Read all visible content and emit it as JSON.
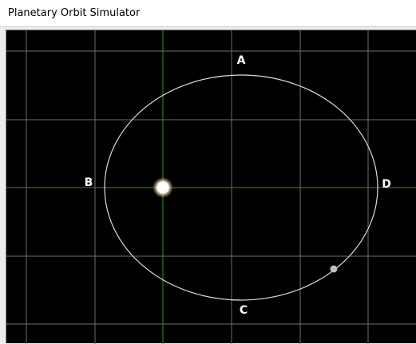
{
  "window": {
    "title": "Planetary Orbit Simulator"
  },
  "simulation": {
    "background_color": "#000000",
    "grid_color": "#6e6e6e",
    "axis_color": "#2f8f2f",
    "orbit_color": "#dcdcdc",
    "star_color": "#ffffff",
    "planet_color": "#bfbfbf",
    "points": {
      "A": "A",
      "B": "B",
      "C": "C",
      "D": "D"
    },
    "icons": {
      "star": "star-glow",
      "planet": "planet-dot"
    }
  }
}
